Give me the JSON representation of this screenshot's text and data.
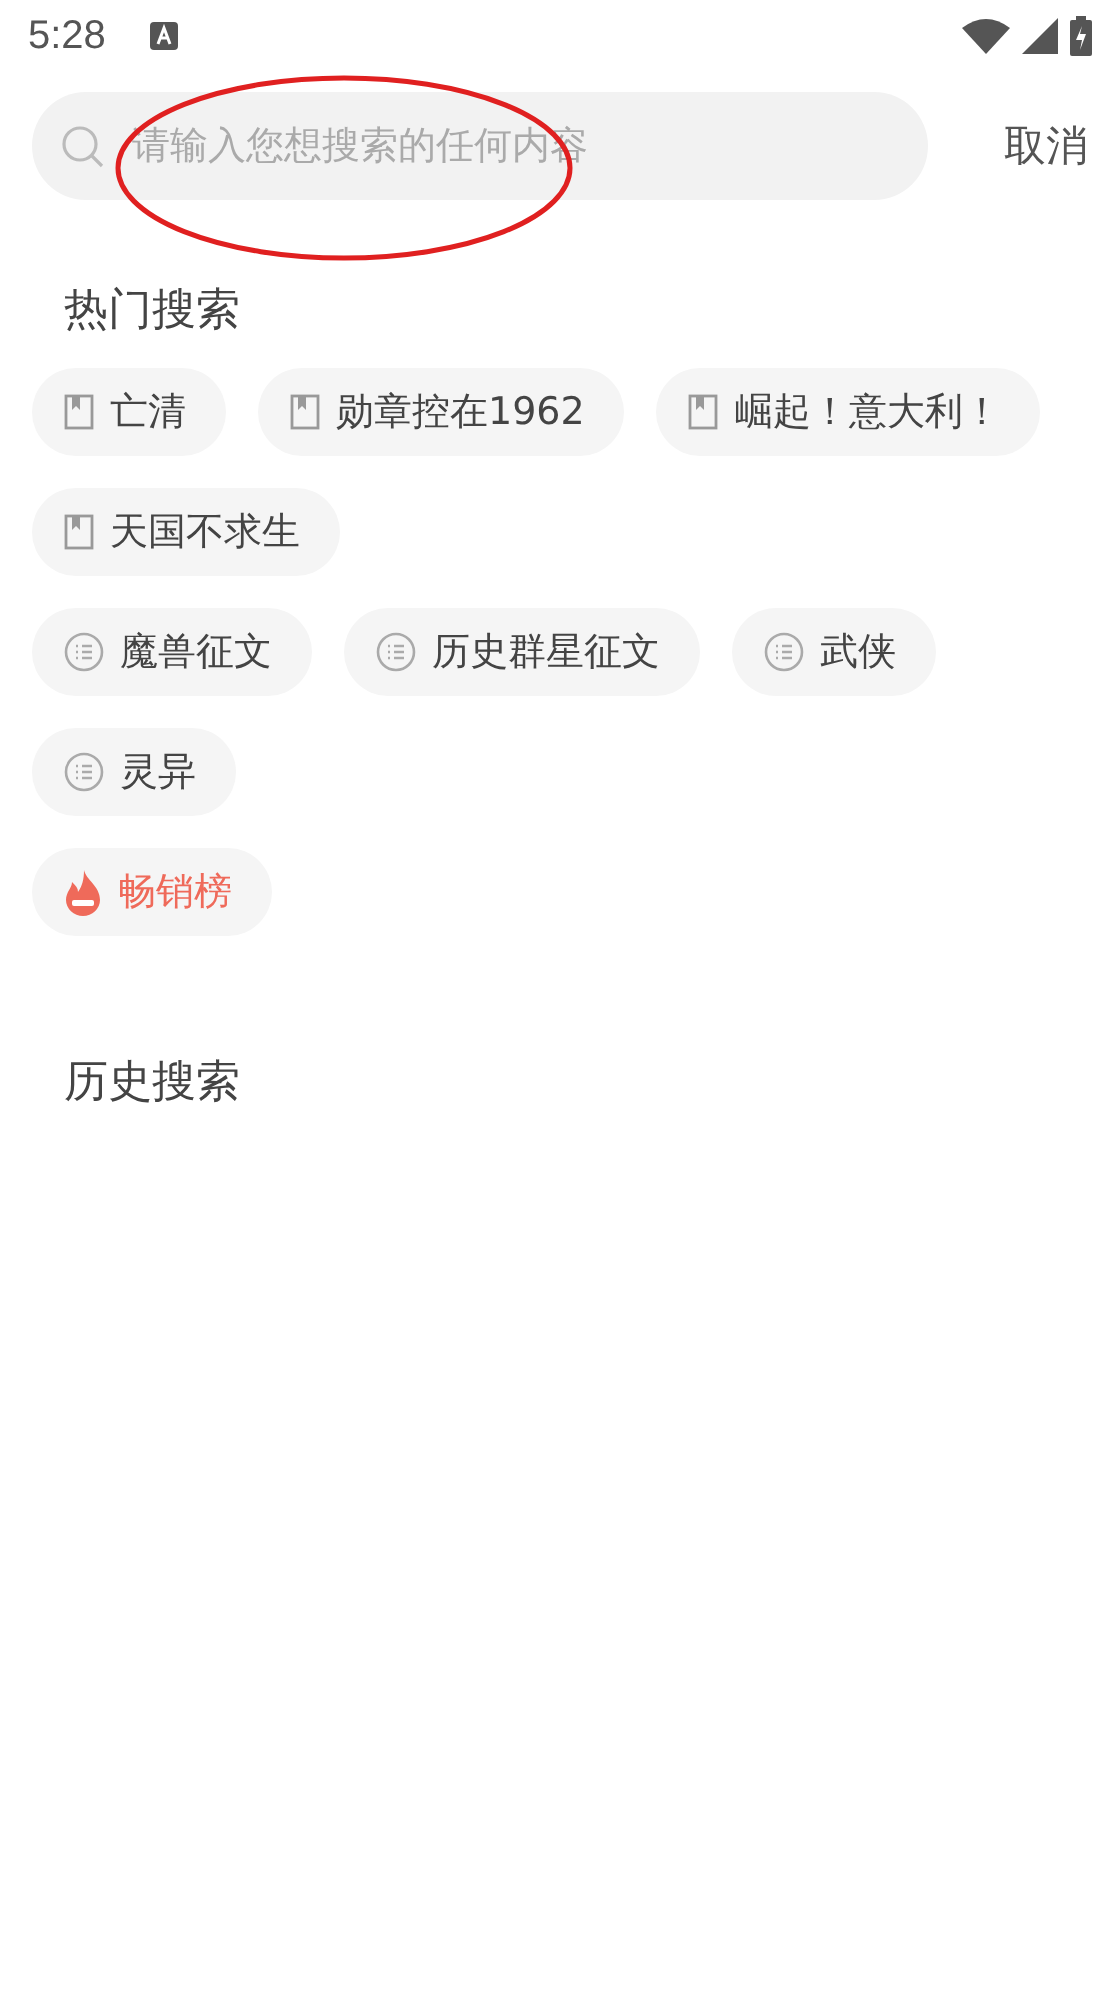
{
  "status_bar": {
    "time": "5:28"
  },
  "search": {
    "placeholder": "请输入您想搜索的任何内容",
    "cancel": "取消"
  },
  "annotation": {
    "kind": "ellipse"
  },
  "hot_searches": {
    "title": "热门搜索",
    "groups": [
      {
        "kind": "book",
        "tags": [
          "亡清",
          "勋章控在1962",
          "崛起！意大利！",
          "天国不求生"
        ]
      },
      {
        "kind": "category",
        "tags": [
          "魔兽征文",
          "历史群星征文",
          "武侠",
          "灵异"
        ]
      },
      {
        "kind": "hot",
        "tags": [
          "畅销榜"
        ]
      }
    ]
  },
  "history": {
    "title": "历史搜索"
  }
}
